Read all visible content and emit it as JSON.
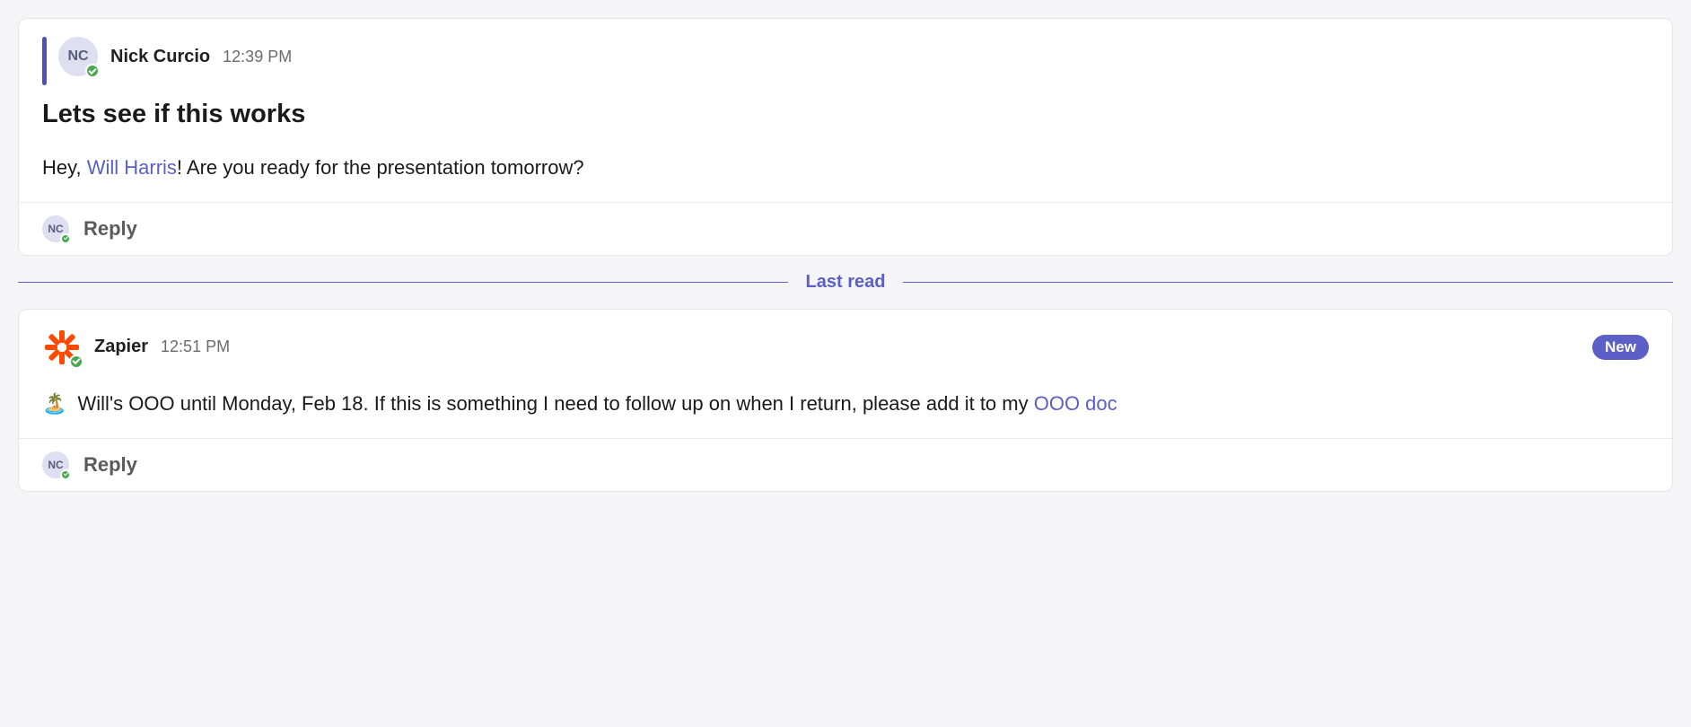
{
  "messages": [
    {
      "author": {
        "name": "Nick Curcio",
        "initials": "NC"
      },
      "timestamp": "12:39 PM",
      "title": "Lets see if this works",
      "body_prefix": "Hey, ",
      "mention": "Will Harris",
      "body_suffix": "! Are you ready for the presentation tomorrow?",
      "reply_avatar_initials": "NC",
      "reply_label": "Reply"
    },
    {
      "author": {
        "name": "Zapier"
      },
      "timestamp": "12:51 PM",
      "new_badge": "New",
      "emoji": "🏝️",
      "body_text": " Will's OOO until Monday, Feb 18. If this is something I need to follow up on when I return, please add it to my ",
      "body_link": "OOO doc",
      "reply_avatar_initials": "NC",
      "reply_label": "Reply"
    }
  ],
  "divider_label": "Last read"
}
